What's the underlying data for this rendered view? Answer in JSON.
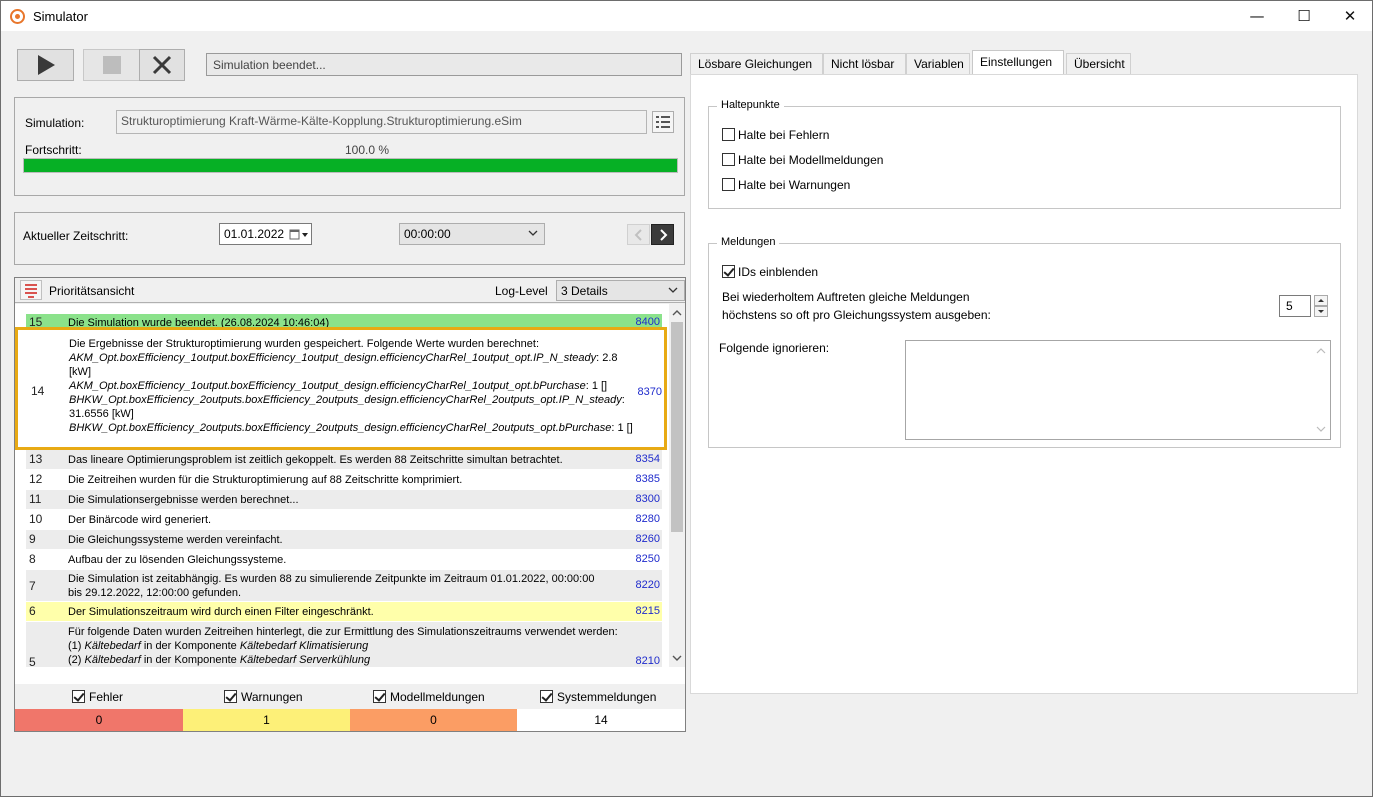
{
  "window": {
    "title": "Simulator",
    "minimize_glyph": "—",
    "maximize_glyph": "☐",
    "close_glyph": "✕"
  },
  "toolbar": {
    "status_text": "Simulation beendet..."
  },
  "simulation": {
    "label": "Simulation:",
    "file": "Strukturoptimierung Kraft-Wärme-Kälte-Kopplung.Strukturoptimierung.eSim",
    "progress_label": "Fortschritt:",
    "progress_text": "100.0 %",
    "progress_value": 1.0
  },
  "timestep": {
    "label": "Aktueller Zeitschritt:",
    "date": "01.01.2022",
    "time": "00:00:00"
  },
  "log": {
    "priority_label": "Prioritätsansicht",
    "loglevel_label": "Log-Level",
    "loglevel_value": "3 Details",
    "rows": [
      {
        "num": "15",
        "msg": "Die Simulation wurde beendet. (26.08.2024 10:46:04)",
        "code": "8400"
      },
      {
        "num": "14",
        "msg_line1": "Die Ergebnisse der Strukturoptimierung wurden gespeichert. Folgende Werte wurden berechnet:",
        "msg_i1": "AKM_Opt.boxEfficiency_1output.boxEfficiency_1output_design.efficiencyCharRel_1output_opt.IP_N_steady",
        "msg_v1": ": 2.8 [kW]",
        "msg_i2": "AKM_Opt.boxEfficiency_1output.boxEfficiency_1output_design.efficiencyCharRel_1output_opt.bPurchase",
        "msg_v2": ": 1 []",
        "msg_i3": "BHKW_Opt.boxEfficiency_2outputs.boxEfficiency_2outputs_design.efficiencyCharRel_2outputs_opt.IP_N_steady",
        "msg_v3": ": 31.6556 [kW]",
        "msg_i4": "BHKW_Opt.boxEfficiency_2outputs.boxEfficiency_2outputs_design.efficiencyCharRel_2outputs_opt.bPurchase",
        "msg_v4": ": 1 []",
        "code": "8370"
      },
      {
        "num": "13",
        "msg": "Das lineare Optimierungsproblem ist zeitlich gekoppelt. Es werden 88 Zeitschritte simultan betrachtet.",
        "code": "8354"
      },
      {
        "num": "12",
        "msg": "Die Zeitreihen wurden für die Strukturoptimierung auf 88 Zeitschritte komprimiert.",
        "code": "8385"
      },
      {
        "num": "11",
        "msg": "Die Simulationsergebnisse werden berechnet...",
        "code": "8300"
      },
      {
        "num": "10",
        "msg": "Der Binärcode wird generiert.",
        "code": "8280"
      },
      {
        "num": "9",
        "msg": "Die Gleichungssysteme werden vereinfacht.",
        "code": "8260"
      },
      {
        "num": "8",
        "msg": "Aufbau der zu lösenden Gleichungssysteme.",
        "code": "8250"
      },
      {
        "num": "7",
        "msg": "Die Simulation ist zeitabhängig. Es wurden 88 zu simulierende Zeitpunkte im Zeitraum 01.01.2022, 00:00:00 bis 29.12.2022, 12:00:00 gefunden.",
        "code": "8220"
      },
      {
        "num": "6",
        "msg": "Der Simulationszeitraum wird durch einen Filter eingeschränkt.",
        "code": "8215"
      },
      {
        "num": "5",
        "msg_line1": "Für folgende Daten wurden Zeitreihen hinterlegt, die zur Ermittlung des Simulationszeitraums verwendet werden:",
        "msg_l2a": "(1) ",
        "msg_l2b": "Kältebedarf",
        "msg_l2c": " in der Komponente ",
        "msg_l2d": "Kältebedarf Klimatisierung",
        "msg_l3a": "(2) ",
        "msg_l3b": "Kältebedarf",
        "msg_l3c": " in der Komponente ",
        "msg_l3d": "Kältebedarf Serverkühlung",
        "code": "8210"
      }
    ]
  },
  "filters": {
    "errors_label": "Fehler",
    "warnings_label": "Warnungen",
    "model_label": "Modellmeldungen",
    "system_label": "Systemmeldungen",
    "errors_count": "0",
    "warnings_count": "1",
    "model_count": "0",
    "system_count": "14"
  },
  "tabs": {
    "t1": "Lösbare Gleichungen",
    "t2": "Nicht lösbar",
    "t3": "Variablen",
    "t4": "Einstellungen",
    "t5": "Übersicht"
  },
  "settings": {
    "breakpoints_title": "Haltepunkte",
    "bp_errors": "Halte bei Fehlern",
    "bp_model": "Halte bei Modellmeldungen",
    "bp_warnings": "Halte bei Warnungen",
    "messages_title": "Meldungen",
    "show_ids": "IDs einblenden",
    "repeat_line1": "Bei wiederholtem Auftreten gleiche Meldungen",
    "repeat_line2": "höchstens so oft pro Gleichungssystem ausgeben:",
    "repeat_value": "5",
    "ignore_label": "Folgende ignorieren:"
  },
  "colors": {
    "errors_bg": "#f0766a",
    "warnings_bg": "#fdf078",
    "model_bg": "#fb9d64",
    "system_bg": "#ffffff",
    "progress": "#06b025",
    "highlight": "#e8aa14"
  }
}
